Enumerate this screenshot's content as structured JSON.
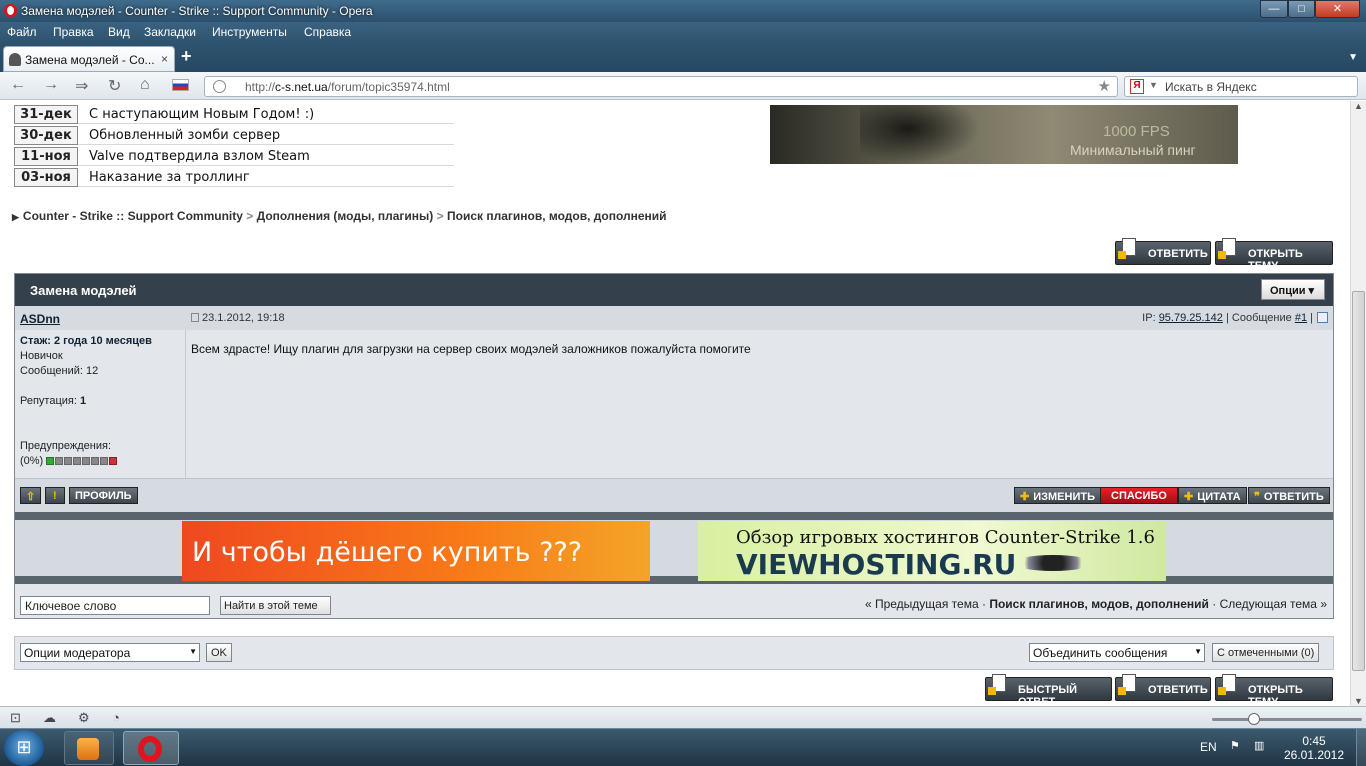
{
  "window": {
    "title": "Замена модэлей - Counter - Strike :: Support Community - Opera",
    "min": "—",
    "max": "□",
    "close": "✕"
  },
  "menu": [
    "Файл",
    "Правка",
    "Вид",
    "Закладки",
    "Инструменты",
    "Справка"
  ],
  "tab": {
    "label": "Замена модэлей - Co...",
    "close": "×",
    "new": "+"
  },
  "address": {
    "prefix": "http://",
    "host": "c-s.net.ua",
    "path": "/forum/topic35974.html"
  },
  "search": {
    "placeholder": "Искать в Яндекс",
    "engine": "Я"
  },
  "news": [
    {
      "date": "31-дек",
      "title": "С наступающим Новым Годом! :)"
    },
    {
      "date": "30-дек",
      "title": "Обновленный зомби сервер"
    },
    {
      "date": "11-ноя",
      "title": "Valve подтвердила взлом Steam"
    },
    {
      "date": "03-ноя",
      "title": "Наказание за троллинг"
    }
  ],
  "top_banner": {
    "line1": "1000 FPS",
    "line2": "Минимальный пинг"
  },
  "breadcrumb": {
    "home": "Counter - Strike :: Support Community",
    "sep": ">",
    "section": "Дополнения (моды, плагины)",
    "subsection": "Поиск плагинов, модов, дополнений"
  },
  "buttons": {
    "reply": "ОТВЕТИТЬ",
    "new_topic": "ОТКРЫТЬ ТЕМУ",
    "quick_reply": "БЫСТРЫЙ ОТВЕТ"
  },
  "thread": {
    "title": "Замена модэлей",
    "options": "Опции ▾"
  },
  "post": {
    "author": "ASDnn",
    "date": "23.1.2012, 19:18",
    "ip_label": "IP:",
    "ip": "95.79.25.142",
    "msg_label": "| Сообщение",
    "msg_num": "#1",
    "sep": "|",
    "text": "Всем здрасте! Ищу плагин для загрузки на сервер своих модэлей заложников пожалуйста помогите",
    "user": {
      "stazh_label": "Стаж:",
      "stazh": "2 года 10 месяцев",
      "rank": "Новичок",
      "posts_label": "Сообщений:",
      "posts": "12",
      "rep_label": "Репутация:",
      "rep": "1",
      "warn_label": "Предупреждения:",
      "warn_pct": "(0%)",
      "warn_level": 0
    }
  },
  "post_actions": {
    "up": "⇧",
    "report": "!",
    "profile": "ПРОФИЛЬ",
    "edit": "ИЗМЕНИТЬ",
    "thanks": "СПАСИБО",
    "quote": "ЦИТАТА",
    "reply": "ОТВЕТИТЬ"
  },
  "ads": {
    "left": "И чтобы дёшего купить  ???",
    "right_line1": "Обзор игровых хостингов Counter-Strike 1.6",
    "right_line2": "VIEWHOSTING.RU"
  },
  "topic_search": {
    "keyword_value": "Ключевое слово",
    "button": "Найти в этой теме",
    "prev": "« Предыдущая тема",
    "dot": "·",
    "current": "Поиск плагинов, модов, дополнений",
    "next": "Следующая тема »"
  },
  "moderation": {
    "options": "Опции модератора",
    "ok": "OK",
    "merge": "Объединить сообщения",
    "with_selected": "С отмеченными (0)"
  },
  "taskbar": {
    "lang": "EN",
    "time": "0:45",
    "date": "26.01.2012"
  },
  "colors": {
    "thread_header": "#34414d",
    "post_bg": "#e3e7eb",
    "thanks_red": "#c8141e",
    "titlebar": "#3f6c8d"
  }
}
